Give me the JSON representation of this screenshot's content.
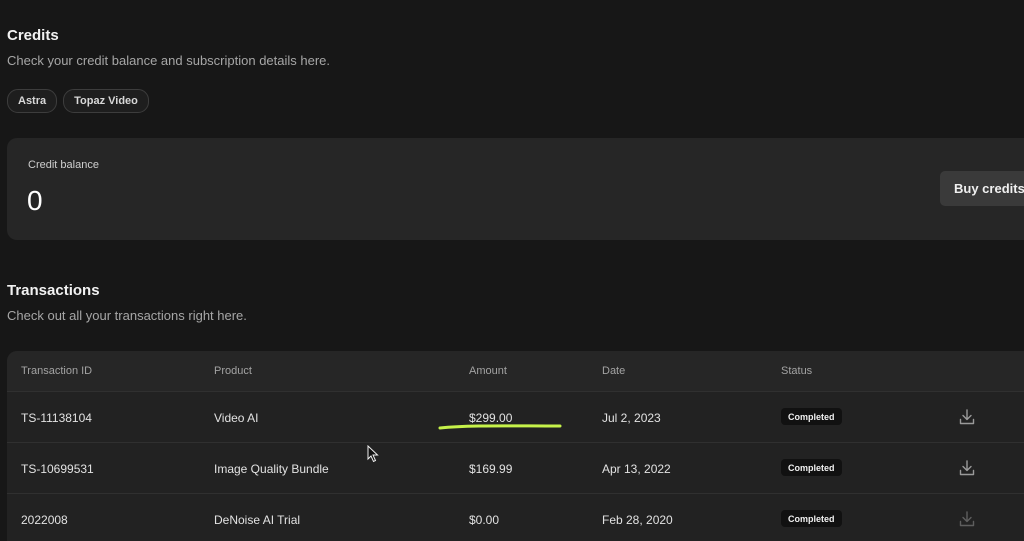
{
  "credits": {
    "title": "Credits",
    "subtitle": "Check your credit balance and subscription details here.",
    "tabs": [
      "Astra",
      "Topaz Video"
    ]
  },
  "balance": {
    "label": "Credit balance",
    "value": "0",
    "buy_label": "Buy credits"
  },
  "transactions": {
    "title": "Transactions",
    "subtitle": "Check out all your transactions right here.",
    "headers": {
      "id": "Transaction ID",
      "product": "Product",
      "amount": "Amount",
      "date": "Date",
      "status": "Status"
    },
    "rows": [
      {
        "id": "TS-11138104",
        "product": "Video AI",
        "amount": "$299.00",
        "date": "Jul 2, 2023",
        "status": "Completed",
        "icon": "download-icon"
      },
      {
        "id": "TS-10699531",
        "product": "Image Quality Bundle",
        "amount": "$169.99",
        "date": "Apr 13, 2022",
        "status": "Completed",
        "icon": "download-icon"
      },
      {
        "id": "2022008",
        "product": "DeNoise AI Trial",
        "amount": "$0.00",
        "date": "Feb 28, 2020",
        "status": "Completed",
        "icon": "download-icon"
      }
    ]
  },
  "colors": {
    "background": "#171717",
    "card": "#262626",
    "highlight": "#c6f24a"
  }
}
